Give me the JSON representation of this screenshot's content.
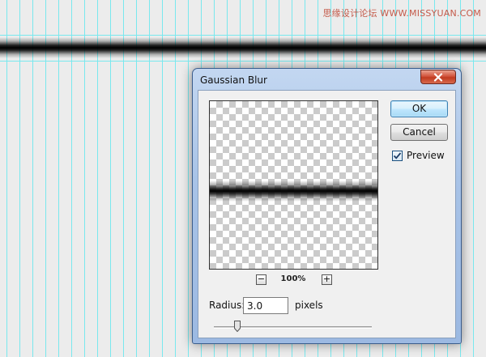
{
  "watermark": "思缘设计论坛 WWW.MISSYUAN.COM",
  "dialog": {
    "title": "Gaussian Blur",
    "ok_label": "OK",
    "cancel_label": "Cancel",
    "preview_label": "Preview",
    "preview_checked": true,
    "zoom_level": "100%",
    "zoom_out_symbol": "−",
    "zoom_in_symbol": "+",
    "radius_label": "Radius:",
    "radius_value": "3.0",
    "radius_unit": "pixels",
    "radius_slider_level": 0.15
  },
  "icons": {
    "close": "close-icon",
    "check": "check-icon",
    "slider_thumb": "slider-thumb-icon"
  },
  "colors": {
    "guide": "#79e8ee",
    "close_button": "#c8432a",
    "ok_button": "#bee6fd",
    "title_bar": "#a8c3e7"
  }
}
